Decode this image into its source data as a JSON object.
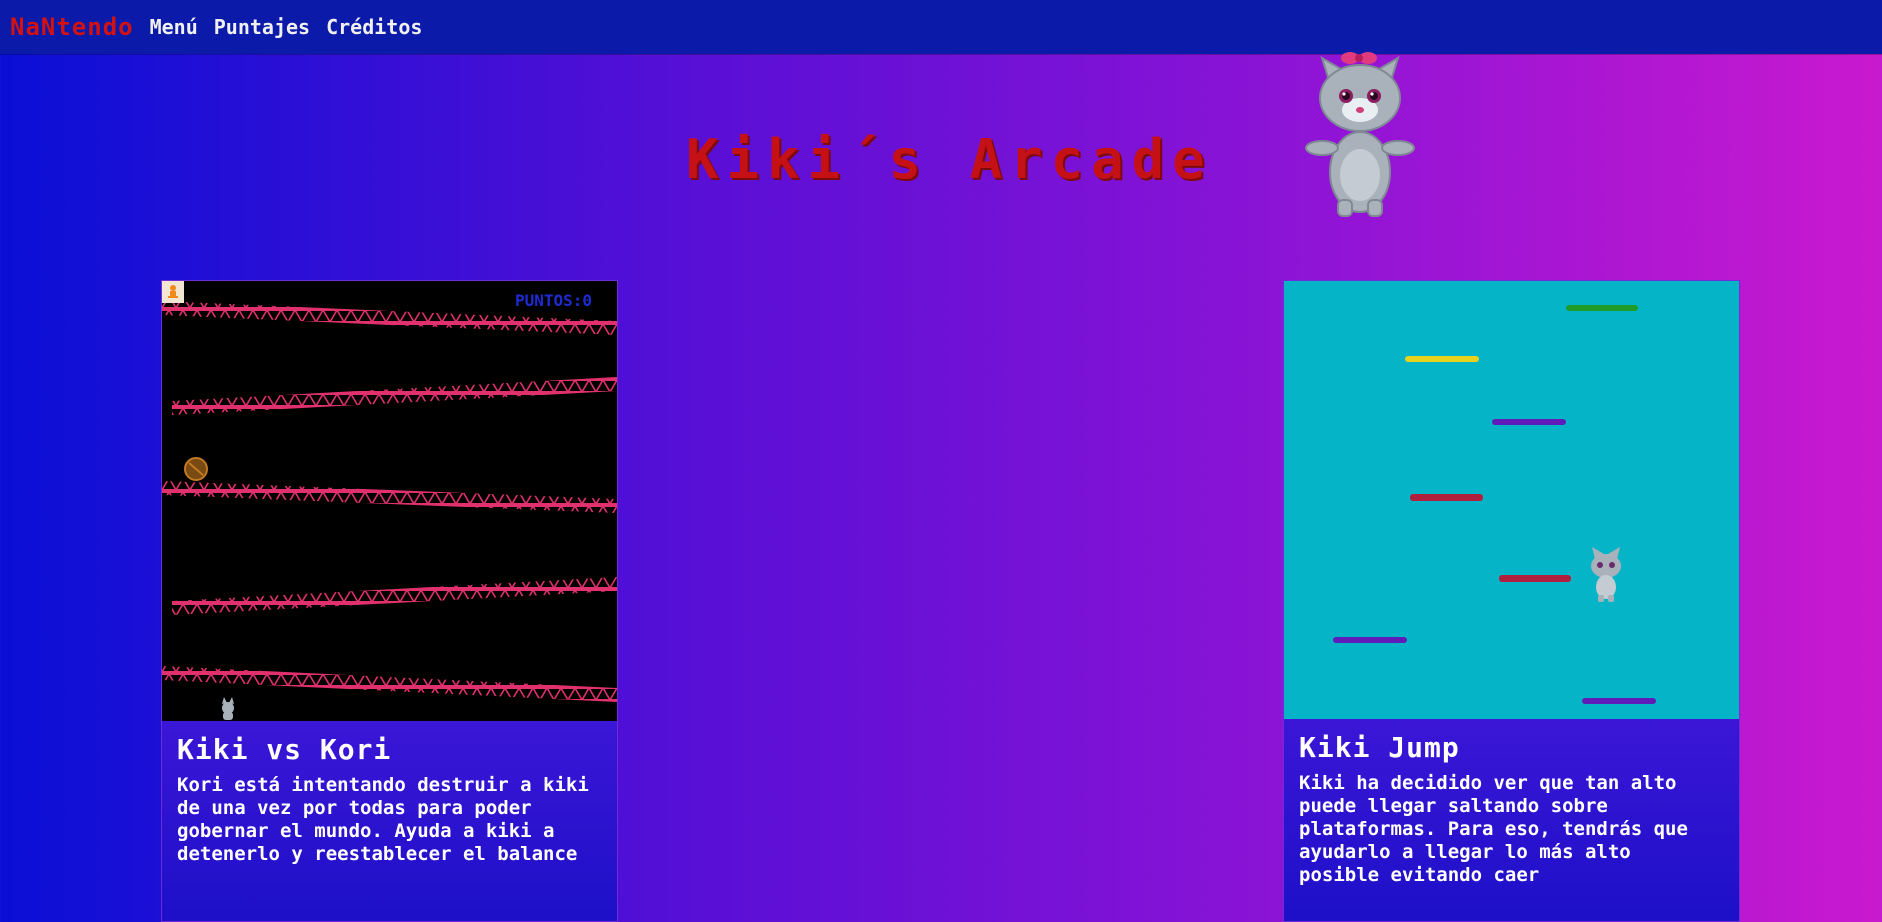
{
  "nav": {
    "brand": "NaNtendo",
    "links": [
      "Menú",
      "Puntajes",
      "Créditos"
    ]
  },
  "header": {
    "title": "Kiki´s Arcade"
  },
  "games": [
    {
      "title": "Kiki vs Kori",
      "description": "Kori está intentando destruir a kiki de una vez por todas para poder gobernar el mundo. Ayuda a kiki a detenerlo y reestablecer el balance",
      "score_label": "PUNTOS:0"
    },
    {
      "title": "Kiki Jump",
      "description": "Kiki ha decidido ver que tan alto puede llegar saltando sobre plataformas. Para eso, tendrás que ayudarlo a llegar lo más alto posible evitando caer"
    }
  ],
  "colors": {
    "navbar": "#0b1aa8",
    "brand": "#d21212",
    "title": "#c51016",
    "girder": "#e0306e",
    "jump_bg": "#05b4c6"
  },
  "icons": [
    "cat-mascot-icon",
    "barrel-icon",
    "player-icon",
    "kiki-player-icon"
  ]
}
